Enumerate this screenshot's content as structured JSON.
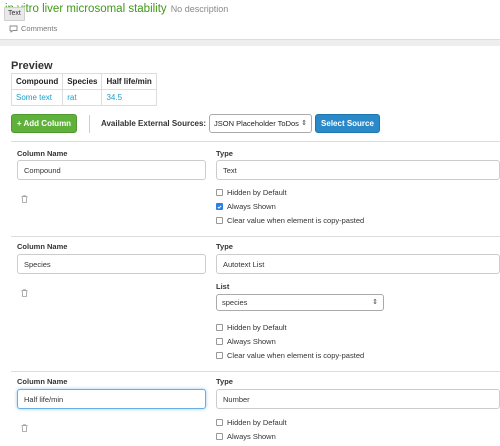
{
  "header": {
    "title": "in vitro liver microsomal stability",
    "description": "No description",
    "tooltip": "Text",
    "comments_label": "Comments"
  },
  "preview": {
    "title": "Preview",
    "columns": [
      "Compound",
      "Species",
      "Half life/min"
    ],
    "rows": [
      [
        "Some text",
        "rat",
        "34.5"
      ]
    ]
  },
  "toolbar": {
    "add_label": "+ Add Column",
    "sources_label": "Available External Sources:",
    "source_value": "JSON Placeholder ToDos",
    "select_source_label": "Select Source"
  },
  "labels": {
    "column_name": "Column Name",
    "type": "Type",
    "list": "List",
    "hidden": "Hidden by Default",
    "always": "Always Shown",
    "clear": "Clear value when element is copy-pasted"
  },
  "columns": [
    {
      "name": "Compound",
      "type": "Text",
      "hidden": false,
      "always": true,
      "clear": false
    },
    {
      "name": "Species",
      "type": "Autotext List",
      "list": "species",
      "hidden": false,
      "always": false,
      "clear": false
    },
    {
      "name": "Half life/min",
      "type": "Number",
      "hidden": false,
      "always": false
    }
  ],
  "colors": {
    "accent_green": "#5fb13c",
    "accent_blue": "#2a8ac9",
    "link": "#1aa0cc",
    "title_green": "#3f9a17"
  }
}
